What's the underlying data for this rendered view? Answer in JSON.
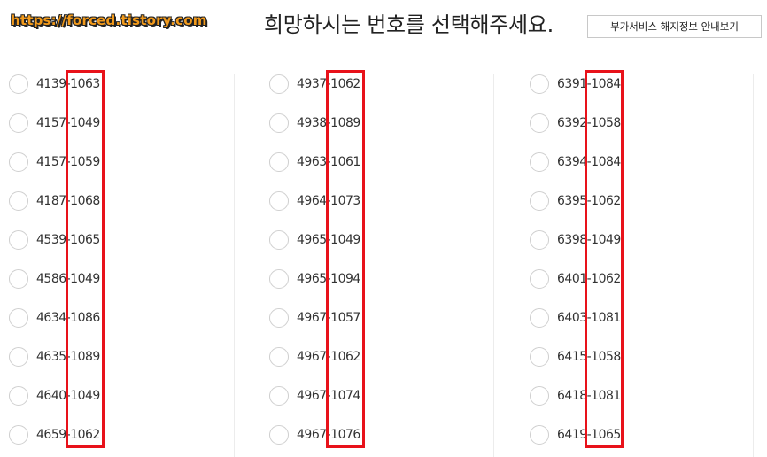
{
  "watermark": "https://forced.tistory.com",
  "title": "희망하시는 번호를 선택해주세요.",
  "info_button": "부가서비스 해지정보 안내보기",
  "columns": [
    {
      "numbers": [
        "4139-1063",
        "4157-1049",
        "4157-1059",
        "4187-1068",
        "4539-1065",
        "4586-1049",
        "4634-1086",
        "4635-1089",
        "4640-1049",
        "4659-1062"
      ]
    },
    {
      "numbers": [
        "4937-1062",
        "4938-1089",
        "4963-1061",
        "4964-1073",
        "4965-1049",
        "4965-1094",
        "4967-1057",
        "4967-1062",
        "4967-1074",
        "4967-1076"
      ]
    },
    {
      "numbers": [
        "6391-1084",
        "6392-1058",
        "6394-1084",
        "6395-1062",
        "6398-1049",
        "6401-1062",
        "6403-1081",
        "6415-1058",
        "6418-1081",
        "6419-1065"
      ]
    }
  ],
  "colors": {
    "highlight": "#e8121a",
    "watermark": "#f29a1b",
    "radio_border": "#cfcfcf"
  }
}
